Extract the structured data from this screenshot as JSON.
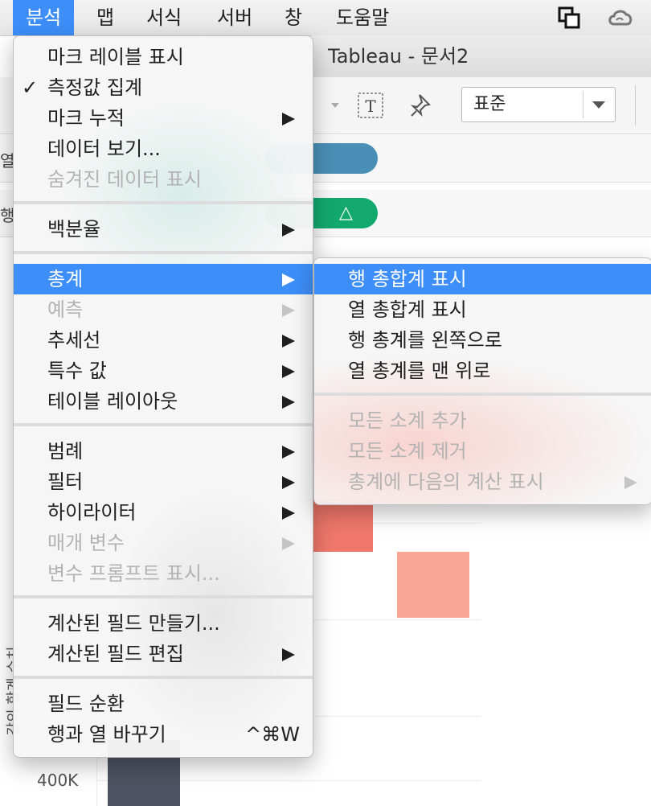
{
  "menubar": {
    "items": [
      "분석",
      "맵",
      "서식",
      "서버",
      "창",
      "도움말"
    ],
    "active_index": 0
  },
  "window": {
    "title": "Tableau - 문서2"
  },
  "toolbar": {
    "fit_dropdown_value": "표준"
  },
  "shelves": {
    "columns_label": "열",
    "rows_label": "행",
    "rows_pill_text": "△"
  },
  "axis": {
    "tick_label": "400K",
    "title_fragment": "값의 합계 수치"
  },
  "colors": {
    "menu_highlight": "#3d8ef8",
    "columns_pill": "#4a8fb5",
    "rows_pill": "#12a86e",
    "bar_dark_red": "#f0786a",
    "bar_light_red": "#fba595",
    "bar_slate": "#4d5362"
  },
  "analysis_menu": {
    "items": [
      {
        "label": "마크 레이블 표시",
        "checked": false,
        "submenu": false,
        "disabled": false
      },
      {
        "label": "측정값 집계",
        "checked": true,
        "submenu": false,
        "disabled": false
      },
      {
        "label": "마크 누적",
        "checked": false,
        "submenu": true,
        "disabled": false
      },
      {
        "label": "데이터 보기...",
        "checked": false,
        "submenu": false,
        "disabled": false
      },
      {
        "label": "숨겨진 데이터 표시",
        "checked": false,
        "submenu": false,
        "disabled": true
      },
      {
        "label": "백분율",
        "checked": false,
        "submenu": true,
        "disabled": false
      },
      {
        "label": "총계",
        "checked": false,
        "submenu": true,
        "disabled": false,
        "highlighted": true
      },
      {
        "label": "예측",
        "checked": false,
        "submenu": true,
        "disabled": true
      },
      {
        "label": "추세선",
        "checked": false,
        "submenu": true,
        "disabled": false
      },
      {
        "label": "특수 값",
        "checked": false,
        "submenu": true,
        "disabled": false
      },
      {
        "label": "테이블 레이아웃",
        "checked": false,
        "submenu": true,
        "disabled": false
      },
      {
        "label": "범례",
        "checked": false,
        "submenu": true,
        "disabled": false
      },
      {
        "label": "필터",
        "checked": false,
        "submenu": true,
        "disabled": false
      },
      {
        "label": "하이라이터",
        "checked": false,
        "submenu": true,
        "disabled": false
      },
      {
        "label": "매개 변수",
        "checked": false,
        "submenu": true,
        "disabled": true
      },
      {
        "label": "변수 프롬프트 표시...",
        "checked": false,
        "submenu": false,
        "disabled": true
      },
      {
        "label": "계산된 필드 만들기...",
        "checked": false,
        "submenu": false,
        "disabled": false
      },
      {
        "label": "계산된 필드 편집",
        "checked": false,
        "submenu": true,
        "disabled": false
      },
      {
        "label": "필드 순환",
        "checked": false,
        "submenu": false,
        "disabled": false
      },
      {
        "label": "행과 열 바꾸기",
        "checked": false,
        "submenu": false,
        "disabled": false,
        "shortcut": "^⌘W"
      }
    ],
    "check_glyph": "✓"
  },
  "totals_submenu": {
    "items": [
      {
        "label": "행 총합계 표시",
        "disabled": false,
        "highlighted": true
      },
      {
        "label": "열 총합계 표시",
        "disabled": false
      },
      {
        "label": "행 총계를 왼쪽으로",
        "disabled": false
      },
      {
        "label": "열 총계를 맨 위로",
        "disabled": false
      },
      {
        "label": "모든 소계 추가",
        "disabled": true
      },
      {
        "label": "모든 소계 제거",
        "disabled": true
      },
      {
        "label": "총계에 다음의 계산 표시",
        "disabled": true,
        "submenu": true
      }
    ]
  }
}
